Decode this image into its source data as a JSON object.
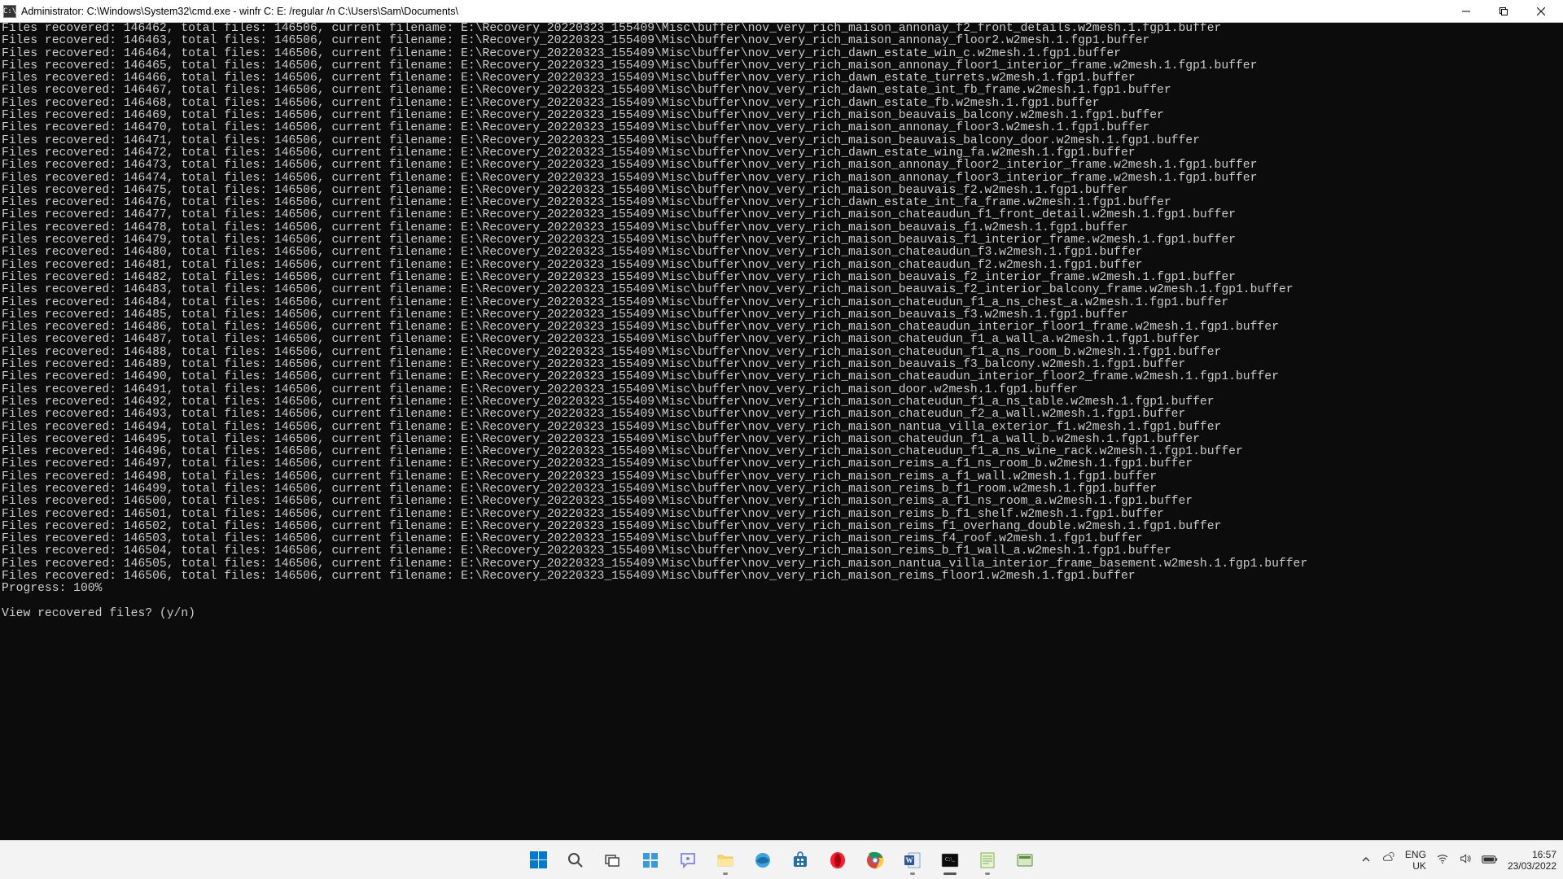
{
  "window": {
    "title": "Administrator: C:\\Windows\\System32\\cmd.exe - winfr  C: E: /regular /n C:\\Users\\Sam\\Documents\\"
  },
  "console": {
    "total_files": 146506,
    "line_prefix_template": "Files recovered: {n}, total files: {total}, current filename: ",
    "path_prefix": "E:\\Recovery_20220323_155409\\Misc\\buffer\\",
    "entries": [
      {
        "n": 146462,
        "file": "nov_very_rich_maison_annonay_f2_front_details.w2mesh.1.fgp1.buffer"
      },
      {
        "n": 146463,
        "file": "nov_very_rich_maison_annonay_floor2.w2mesh.1.fgp1.buffer"
      },
      {
        "n": 146464,
        "file": "nov_very_rich_dawn_estate_win_c.w2mesh.1.fgp1.buffer"
      },
      {
        "n": 146465,
        "file": "nov_very_rich_maison_annonay_floor1_interior_frame.w2mesh.1.fgp1.buffer"
      },
      {
        "n": 146466,
        "file": "nov_very_rich_dawn_estate_turrets.w2mesh.1.fgp1.buffer"
      },
      {
        "n": 146467,
        "file": "nov_very_rich_dawn_estate_int_fb_frame.w2mesh.1.fgp1.buffer"
      },
      {
        "n": 146468,
        "file": "nov_very_rich_dawn_estate_fb.w2mesh.1.fgp1.buffer"
      },
      {
        "n": 146469,
        "file": "nov_very_rich_maison_beauvais_balcony.w2mesh.1.fgp1.buffer"
      },
      {
        "n": 146470,
        "file": "nov_very_rich_maison_annonay_floor3.w2mesh.1.fgp1.buffer"
      },
      {
        "n": 146471,
        "file": "nov_very_rich_maison_beauvais_balcony_door.w2mesh.1.fgp1.buffer"
      },
      {
        "n": 146472,
        "file": "nov_very_rich_dawn_estate_wing_fa.w2mesh.1.fgp1.buffer"
      },
      {
        "n": 146473,
        "file": "nov_very_rich_maison_annonay_floor2_interior_frame.w2mesh.1.fgp1.buffer"
      },
      {
        "n": 146474,
        "file": "nov_very_rich_maison_annonay_floor3_interior_frame.w2mesh.1.fgp1.buffer"
      },
      {
        "n": 146475,
        "file": "nov_very_rich_maison_beauvais_f2.w2mesh.1.fgp1.buffer"
      },
      {
        "n": 146476,
        "file": "nov_very_rich_dawn_estate_int_fa_frame.w2mesh.1.fgp1.buffer"
      },
      {
        "n": 146477,
        "file": "nov_very_rich_maison_chateaudun_f1_front_detail.w2mesh.1.fgp1.buffer"
      },
      {
        "n": 146478,
        "file": "nov_very_rich_maison_beauvais_f1.w2mesh.1.fgp1.buffer"
      },
      {
        "n": 146479,
        "file": "nov_very_rich_maison_beauvais_f1_interior_frame.w2mesh.1.fgp1.buffer"
      },
      {
        "n": 146480,
        "file": "nov_very_rich_maison_chateaudun_f3.w2mesh.1.fgp1.buffer"
      },
      {
        "n": 146481,
        "file": "nov_very_rich_maison_chateaudun_f2.w2mesh.1.fgp1.buffer"
      },
      {
        "n": 146482,
        "file": "nov_very_rich_maison_beauvais_f2_interior_frame.w2mesh.1.fgp1.buffer"
      },
      {
        "n": 146483,
        "file": "nov_very_rich_maison_beauvais_f2_interior_balcony_frame.w2mesh.1.fgp1.buffer"
      },
      {
        "n": 146484,
        "file": "nov_very_rich_maison_chateudun_f1_a_ns_chest_a.w2mesh.1.fgp1.buffer"
      },
      {
        "n": 146485,
        "file": "nov_very_rich_maison_beauvais_f3.w2mesh.1.fgp1.buffer"
      },
      {
        "n": 146486,
        "file": "nov_very_rich_maison_chateaudun_interior_floor1_frame.w2mesh.1.fgp1.buffer"
      },
      {
        "n": 146487,
        "file": "nov_very_rich_maison_chateudun_f1_a_wall_a.w2mesh.1.fgp1.buffer"
      },
      {
        "n": 146488,
        "file": "nov_very_rich_maison_chateudun_f1_a_ns_room_b.w2mesh.1.fgp1.buffer"
      },
      {
        "n": 146489,
        "file": "nov_very_rich_maison_beauvais_f3_balcony.w2mesh.1.fgp1.buffer"
      },
      {
        "n": 146490,
        "file": "nov_very_rich_maison_chateaudun_interior_floor2_frame.w2mesh.1.fgp1.buffer"
      },
      {
        "n": 146491,
        "file": "nov_very_rich_maison_door.w2mesh.1.fgp1.buffer"
      },
      {
        "n": 146492,
        "file": "nov_very_rich_maison_chateudun_f1_a_ns_table.w2mesh.1.fgp1.buffer"
      },
      {
        "n": 146493,
        "file": "nov_very_rich_maison_chateudun_f2_a_wall.w2mesh.1.fgp1.buffer"
      },
      {
        "n": 146494,
        "file": "nov_very_rich_maison_nantua_villa_exterior_f1.w2mesh.1.fgp1.buffer"
      },
      {
        "n": 146495,
        "file": "nov_very_rich_maison_chateudun_f1_a_wall_b.w2mesh.1.fgp1.buffer"
      },
      {
        "n": 146496,
        "file": "nov_very_rich_maison_chateudun_f1_a_ns_wine_rack.w2mesh.1.fgp1.buffer"
      },
      {
        "n": 146497,
        "file": "nov_very_rich_maison_reims_a_f1_ns_room_b.w2mesh.1.fgp1.buffer"
      },
      {
        "n": 146498,
        "file": "nov_very_rich_maison_reims_a_f1_wall.w2mesh.1.fgp1.buffer"
      },
      {
        "n": 146499,
        "file": "nov_very_rich_maison_reims_b_f1_room.w2mesh.1.fgp1.buffer"
      },
      {
        "n": 146500,
        "file": "nov_very_rich_maison_reims_a_f1_ns_room_a.w2mesh.1.fgp1.buffer"
      },
      {
        "n": 146501,
        "file": "nov_very_rich_maison_reims_b_f1_shelf.w2mesh.1.fgp1.buffer"
      },
      {
        "n": 146502,
        "file": "nov_very_rich_maison_reims_f1_overhang_double.w2mesh.1.fgp1.buffer"
      },
      {
        "n": 146503,
        "file": "nov_very_rich_maison_reims_f4_roof.w2mesh.1.fgp1.buffer"
      },
      {
        "n": 146504,
        "file": "nov_very_rich_maison_reims_b_f1_wall_a.w2mesh.1.fgp1.buffer"
      },
      {
        "n": 146505,
        "file": "nov_very_rich_maison_nantua_villa_interior_frame_basement.w2mesh.1.fgp1.buffer"
      },
      {
        "n": 146506,
        "file": "nov_very_rich_maison_reims_floor1.w2mesh.1.fgp1.buffer"
      }
    ],
    "progress_line": "Progress: 100%",
    "prompt_line": "View recovered files? (y/n)"
  },
  "tray": {
    "lang": "ENG",
    "region": "UK",
    "time": "16:57",
    "date": "23/03/2022"
  }
}
